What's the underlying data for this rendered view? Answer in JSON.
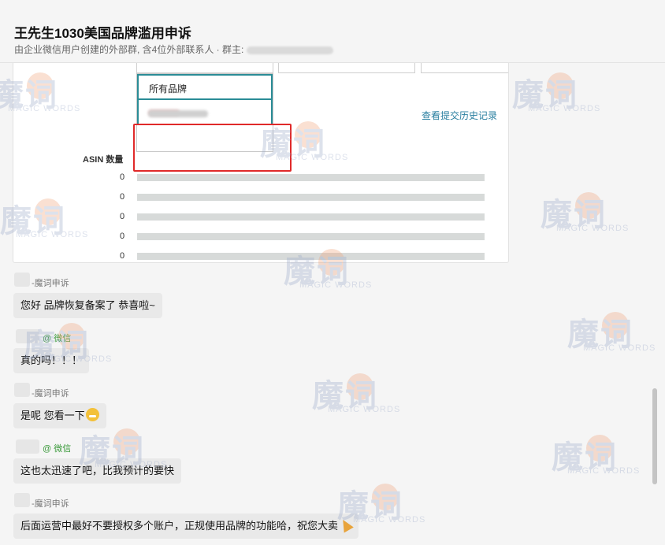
{
  "header": {
    "title": "王先生1030美国品牌滥用申诉",
    "subtitle": "由企业微信用户创建的外部群, 含4位外部联系人 · 群主:"
  },
  "screenshot": {
    "dropdown_first_item": "所有品牌",
    "history_link": "查看提交历史记录",
    "asin_label": "ASIN 数量",
    "zero_values": [
      "0",
      "0",
      "0",
      "0",
      "0"
    ]
  },
  "messages": [
    {
      "sender": "-魔词申诉",
      "text": "您好  品牌恢复备案了 恭喜啦~"
    },
    {
      "sender": "@ 微信",
      "text": "真的吗！！！"
    },
    {
      "sender": "-魔词申诉",
      "text": "是呢 您看一下"
    },
    {
      "sender": "@ 微信",
      "text": "这也太迅速了吧，比我预计的要快"
    },
    {
      "sender": "-魔词申诉",
      "text": "后面运营中最好不要授权多个账户，正规使用品牌的功能哈，祝您大卖"
    }
  ],
  "watermark": {
    "main": "魔词",
    "sub": "MAGIC WORDS",
    "badge": "申诉"
  },
  "icons": [
    "grin-emoji-icon",
    "party-popper-icon"
  ]
}
